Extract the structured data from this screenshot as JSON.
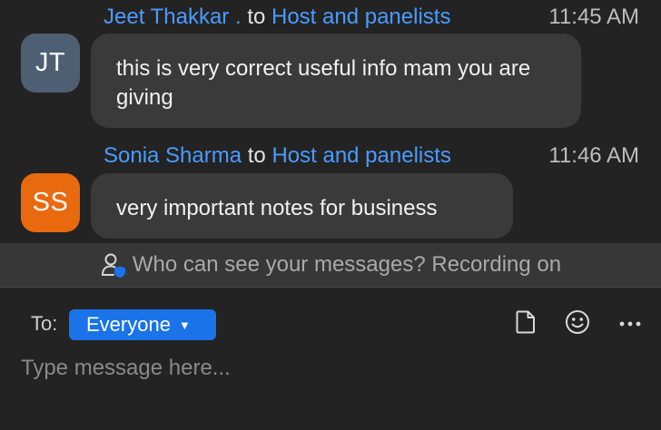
{
  "messages": [
    {
      "sender": "Jeet Thakkar .",
      "connector": "to",
      "recipient": "Host and panelists",
      "time": "11:45 AM",
      "initials": "JT",
      "avatar_color": "#4e5f73",
      "text": "this is very correct useful info mam you are giving"
    },
    {
      "sender": "Sonia Sharma",
      "connector": "to",
      "recipient": "Host and panelists",
      "time": "11:46 AM",
      "initials": "SS",
      "avatar_color": "#e9690f",
      "text": "very important notes for business"
    }
  ],
  "notice": {
    "text": "Who can see your messages? Recording on",
    "icon": "person-shield-icon"
  },
  "composer": {
    "to_label": "To:",
    "recipient": "Everyone",
    "placeholder": "Type message here...",
    "tools": [
      "file-icon",
      "emoji-icon",
      "more-icon"
    ]
  },
  "colors": {
    "background": "#232323",
    "bubble": "#3a3a3a",
    "link": "#4a9bff",
    "accent": "#1a73e8"
  }
}
